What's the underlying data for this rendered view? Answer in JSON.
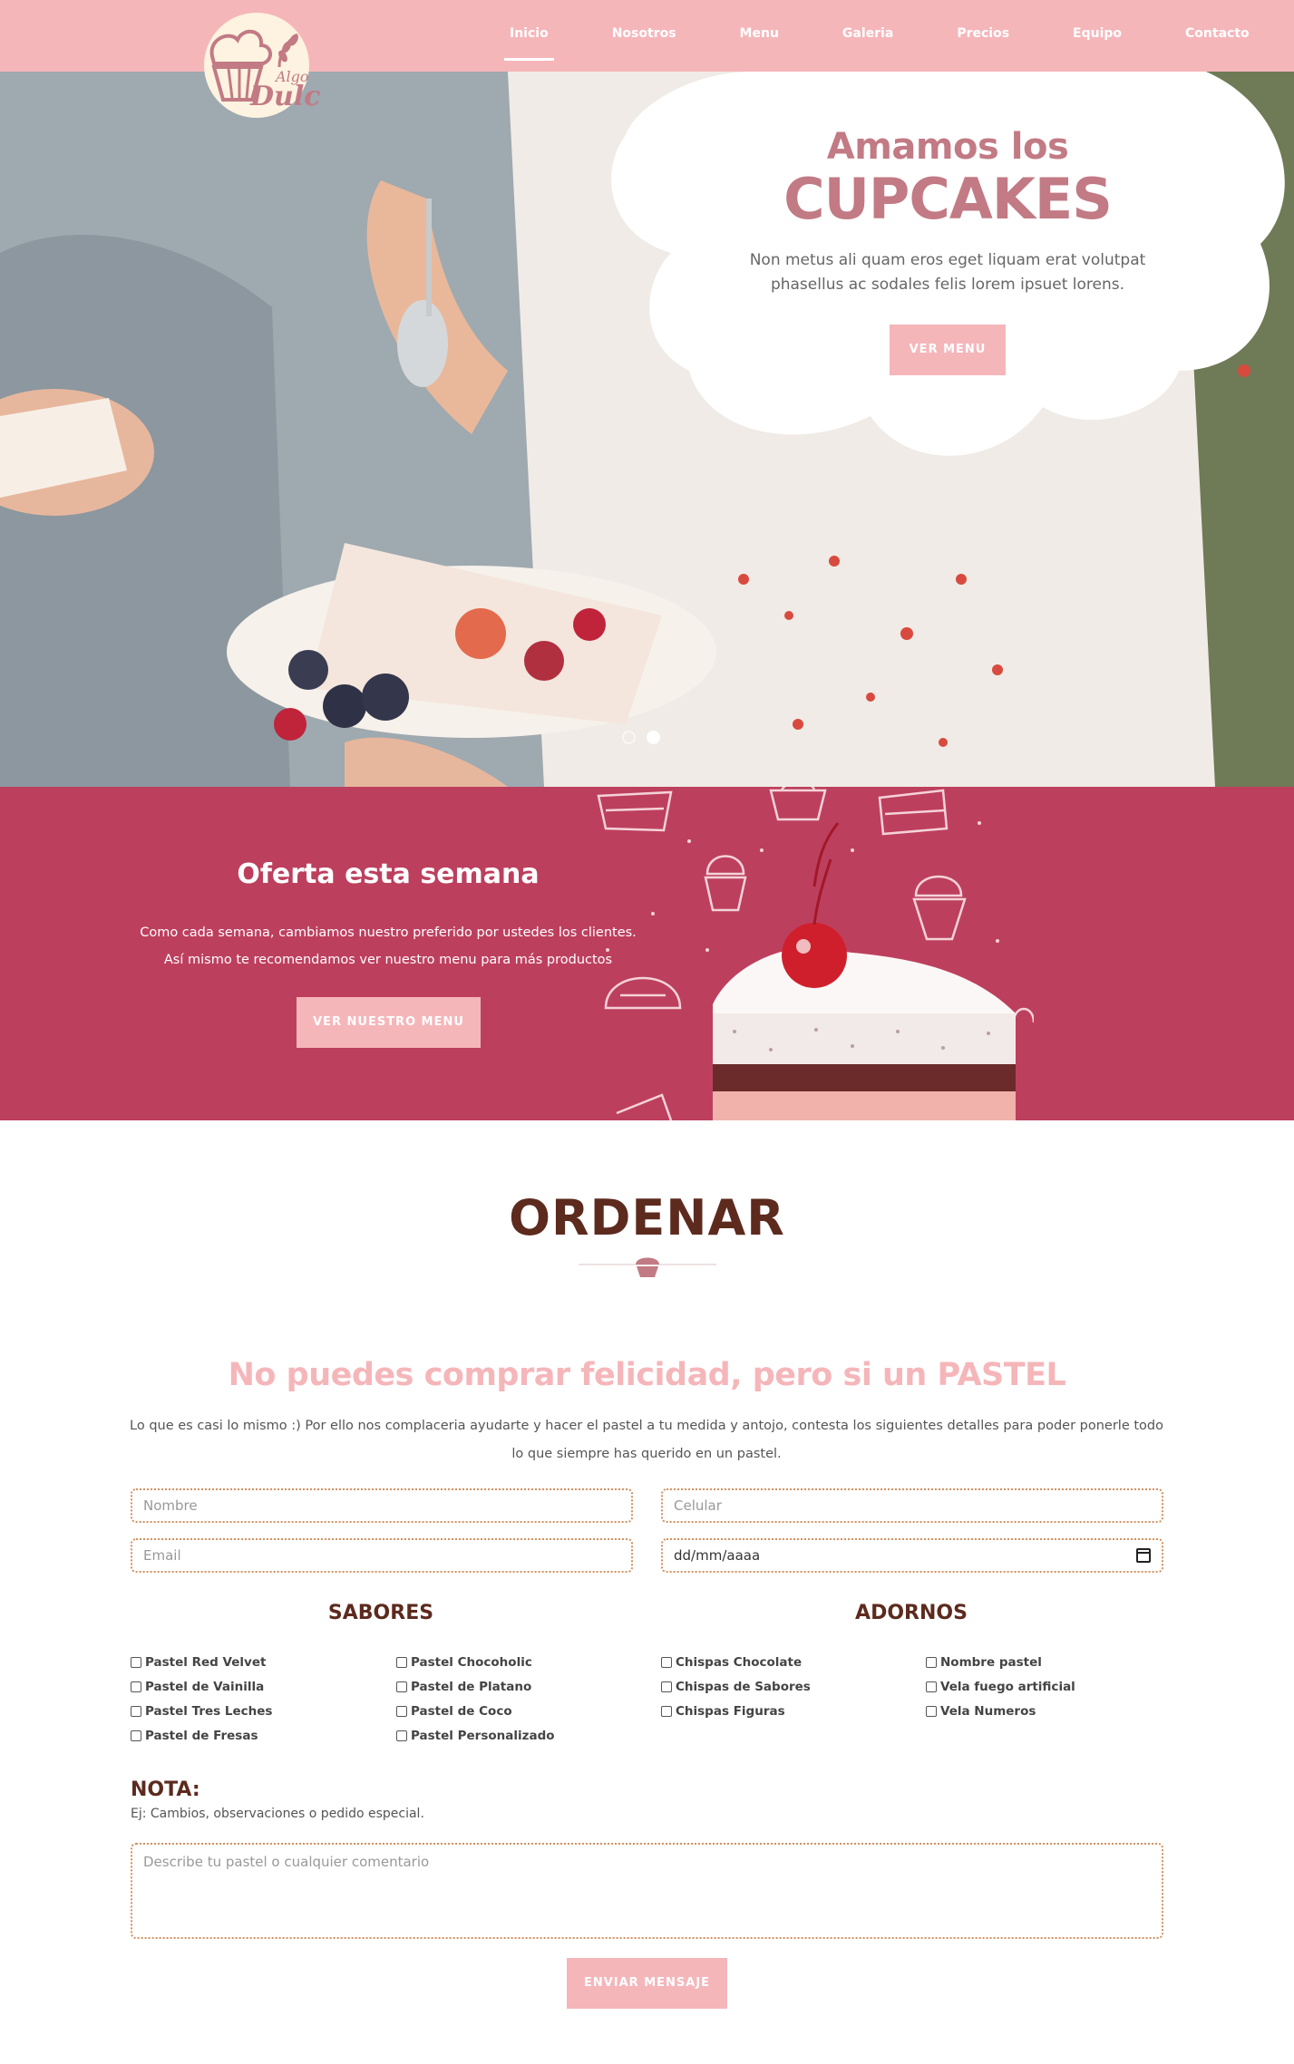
{
  "brand": {
    "logo_small": "Algo",
    "logo_big": "Dulce"
  },
  "nav": {
    "items": [
      "Inicio",
      "Nosotros",
      "Menu",
      "Galeria",
      "Precios",
      "Equipo",
      "Contacto"
    ],
    "active": "Inicio"
  },
  "hero": {
    "line1": "Amamos los",
    "line2": "CUPCAKES",
    "subtitle": "Non metus ali quam eros eget liquam erat volutpat phasellus ac sodales felis lorem ipsuet lorens.",
    "button": "VER MENU",
    "slides_total": 2,
    "slide_active": 2
  },
  "offer": {
    "title": "Oferta esta semana",
    "line1": "Como cada semana, cambiamos nuestro preferido por ustedes los clientes.",
    "line2": "Así mismo te recomendamos ver nuestro menu para más productos",
    "button": "VER NUESTRO MENU"
  },
  "order": {
    "title": "ORDENAR",
    "tagline": "No puedes comprar felicidad, pero si un PASTEL",
    "intro": "Lo que es casi lo mismo :) Por ello nos complaceria ayudarte y hacer el pastel a tu medida y antojo, contesta los siguientes detalles para poder ponerle todo lo que siempre has querido en un pastel.",
    "placeholders": {
      "nombre": "Nombre",
      "celular": "Celular",
      "email": "Email",
      "fecha": "dd/mm/aaaa"
    },
    "sabores": {
      "title": "SABORES",
      "col1": [
        "Pastel Red Velvet",
        "Pastel de Vainilla",
        "Pastel Tres Leches",
        "Pastel de Fresas"
      ],
      "col2": [
        "Pastel Chocoholic",
        "Pastel de Platano",
        "Pastel de Coco",
        "Pastel Personalizado"
      ]
    },
    "adornos": {
      "title": "ADORNOS",
      "col1": [
        "Chispas Chocolate",
        "Chispas de Sabores",
        "Chispas Figuras"
      ],
      "col2": [
        "Nombre pastel",
        "Vela fuego artificial",
        "Vela Numeros"
      ]
    },
    "nota_title": "NOTA:",
    "nota_sub": "Ej: Cambios, observaciones o pedido especial.",
    "nota_placeholder": "Describe tu pastel o cualquier comentario",
    "send": "ENVIAR MENSAJE"
  },
  "colors": {
    "nav": "#f5b6ba",
    "offer_bg": "#bd3f5e",
    "heading_brown": "#5d2a1e",
    "hero_pink": "#c27a84"
  }
}
